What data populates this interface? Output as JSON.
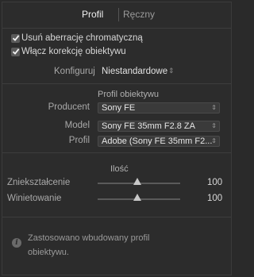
{
  "tabs": {
    "profil": "Profil",
    "reczny": "Ręczny"
  },
  "options": {
    "remove_ca": {
      "label": "Usuń aberrację chromatyczną",
      "checked": true
    },
    "enable_profile": {
      "label": "Włącz korekcję obiektywu",
      "checked": true
    }
  },
  "config": {
    "label": "Konfiguruj",
    "value": "Niestandardowe"
  },
  "lens_profile": {
    "title": "Profil obiektywu",
    "fields": [
      {
        "label": "Producent",
        "value": "Sony FE"
      },
      {
        "label": "Model",
        "value": "Sony FE 35mm F2.8 ZA"
      },
      {
        "label": "Profil",
        "value": "Adobe (Sony FE 35mm F2..."
      }
    ]
  },
  "amount": {
    "title": "Ilość",
    "sliders": [
      {
        "label": "Zniekształcenie",
        "value": "100"
      },
      {
        "label": "Winietowanie",
        "value": "100"
      }
    ]
  },
  "info": {
    "text": "Zastosowano wbudowany profil obiektywu."
  },
  "colors": {
    "panel_bg": "#2c2c2c",
    "text": "#d6d6d6",
    "muted": "#a9a9a9",
    "control_bg": "#3a3a3a"
  }
}
